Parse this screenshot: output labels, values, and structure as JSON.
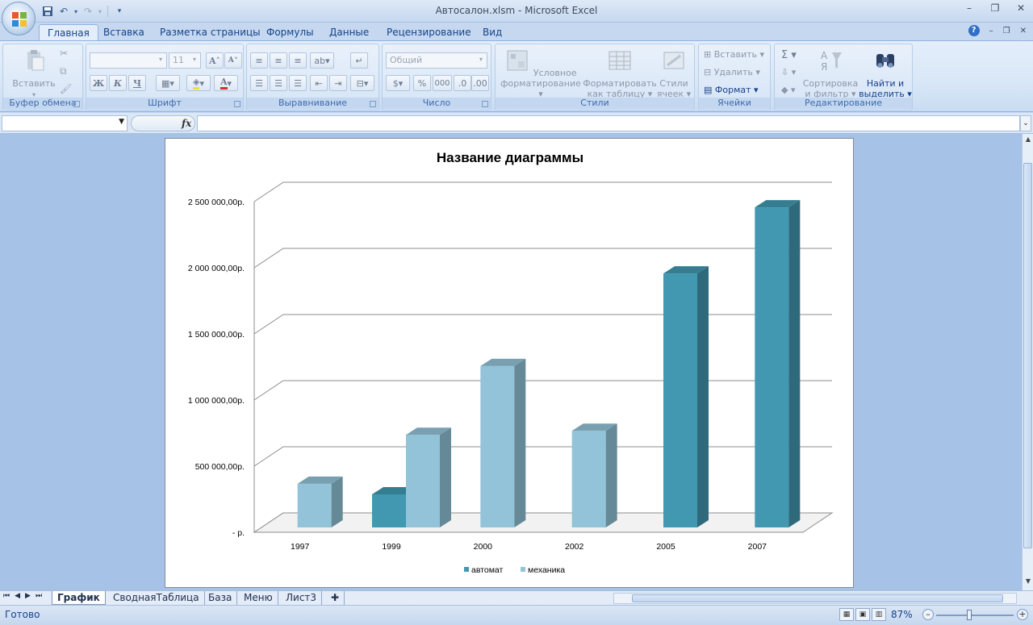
{
  "window": {
    "title": "Автосалон.xlsm - Microsoft Excel"
  },
  "ribbon_tabs": [
    {
      "label": "Главная",
      "active": true
    },
    {
      "label": "Вставка",
      "active": false
    },
    {
      "label": "Разметка страницы",
      "active": false
    },
    {
      "label": "Формулы",
      "active": false
    },
    {
      "label": "Данные",
      "active": false
    },
    {
      "label": "Рецензирование",
      "active": false
    },
    {
      "label": "Вид",
      "active": false
    }
  ],
  "ribbon": {
    "clipboard": {
      "label": "Буфер обмена",
      "paste_label": "Вставить"
    },
    "font": {
      "label": "Шрифт",
      "font_name": "",
      "font_size": "11",
      "bold": "Ж",
      "italic": "К",
      "underline": "Ч"
    },
    "alignment": {
      "label": "Выравнивание"
    },
    "number": {
      "label": "Число",
      "format": "Общий",
      "percent": "%",
      "thousands": "000"
    },
    "styles": {
      "label": "Стили",
      "conditional_line1": "Условное",
      "conditional_line2": "форматирование",
      "table_line1": "Форматировать",
      "table_line2": "как таблицу",
      "cellstyles_line1": "Стили",
      "cellstyles_line2": "ячеек"
    },
    "cells": {
      "label": "Ячейки",
      "insert": "Вставить",
      "delete": "Удалить",
      "format": "Формат"
    },
    "editing": {
      "label": "Редактирование",
      "sigma": "Σ",
      "sort_line1": "Сортировка",
      "sort_line2": "и фильтр",
      "find_line1": "Найти и",
      "find_line2": "выделить"
    }
  },
  "formula_bar": {
    "name_box": "",
    "fx": "fx",
    "formula": ""
  },
  "chart_data": {
    "type": "bar",
    "title": "Название диаграммы",
    "categories": [
      "1997",
      "1999",
      "2000",
      "2002",
      "2005",
      "2007"
    ],
    "series": [
      {
        "name": "автомат",
        "values": [
          null,
          250000,
          null,
          null,
          1920000,
          2420000
        ]
      },
      {
        "name": "механика",
        "values": [
          330000,
          700000,
          1220000,
          730000,
          null,
          null
        ]
      }
    ],
    "y_ticks": [
      "2 500 000,00р.",
      "2 000 000,00р.",
      "1 500 000,00р.",
      "1 000 000,00р.",
      "500 000,00р.",
      "-   р."
    ],
    "ylim": [
      0,
      2500000
    ],
    "grid": true,
    "legend_position": "bottom",
    "colors": {
      "автомат": "#4198b0",
      "механика": "#92c3d8"
    }
  },
  "sheet_tabs": [
    {
      "label": "График",
      "active": true
    },
    {
      "label": "СводнаяТаблица",
      "active": false
    },
    {
      "label": "База",
      "active": false
    },
    {
      "label": "Меню",
      "active": false
    },
    {
      "label": "Лист3",
      "active": false
    }
  ],
  "status": {
    "ready": "Готово",
    "zoom": "87%"
  }
}
